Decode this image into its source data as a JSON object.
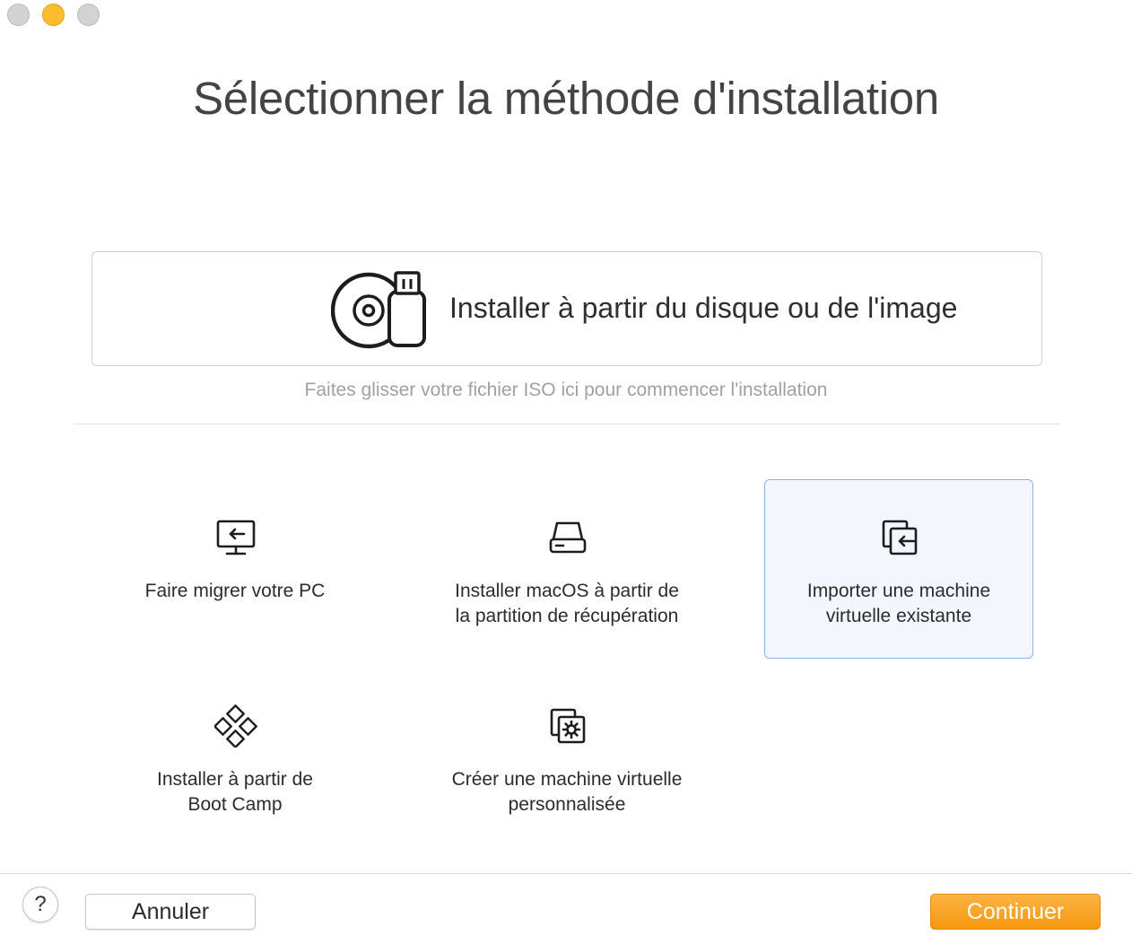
{
  "window": {
    "controls": [
      "close-button",
      "minimize-button",
      "zoom-button"
    ]
  },
  "header": {
    "title": "Sélectionner la méthode d'installation"
  },
  "disk_option": {
    "label": "Installer à partir du disque ou de l'image",
    "icon": "disc-usb-icon"
  },
  "drop_hint": "Faites glisser votre fichier ISO ici pour commencer l'installation",
  "options": [
    {
      "line1": "Faire migrer votre PC",
      "line2": "",
      "icon": "monitor-import-icon",
      "selected": false
    },
    {
      "line1": "Installer macOS à partir de",
      "line2": "la partition de récupération",
      "icon": "hard-drive-icon",
      "selected": false
    },
    {
      "line1": "Importer une machine",
      "line2": "virtuelle existante",
      "icon": "import-vm-icon",
      "selected": true
    },
    {
      "line1": "Installer à partir de",
      "line2": "Boot Camp",
      "icon": "bootcamp-icon",
      "selected": false
    },
    {
      "line1": "Créer une machine virtuelle",
      "line2": "personnalisée",
      "icon": "custom-vm-icon",
      "selected": false
    }
  ],
  "footer": {
    "help_label": "?",
    "cancel_label": "Annuler",
    "continue_label": "Continuer"
  },
  "colors": {
    "accent": "#f5980f",
    "selected_bg": "#f3f7fd",
    "selected_border": "#8fb1e2",
    "minimize_light": "#fbbd2e"
  }
}
